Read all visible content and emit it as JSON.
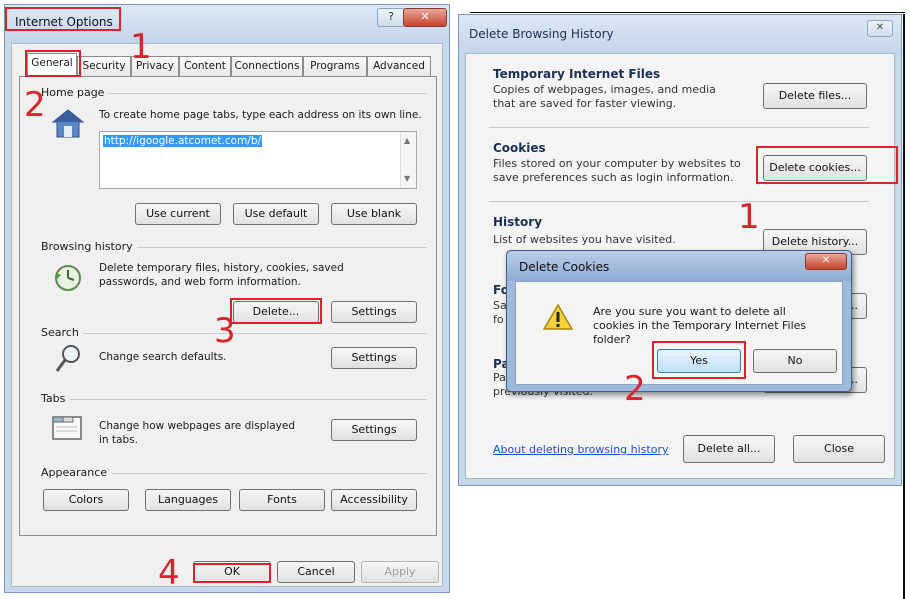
{
  "internet_options": {
    "title": "Internet Options",
    "tabs": [
      "General",
      "Security",
      "Privacy",
      "Content",
      "Connections",
      "Programs",
      "Advanced"
    ],
    "home_page": {
      "label": "Home page",
      "instruction": "To create home page tabs, type each address on its own line.",
      "url": "http://igoogle.atcomet.com/b/",
      "use_current": "Use current",
      "use_default": "Use default",
      "use_blank": "Use blank"
    },
    "browsing_history": {
      "label": "Browsing history",
      "desc": "Delete temporary files, history, cookies, saved passwords, and web form information.",
      "delete": "Delete...",
      "settings": "Settings"
    },
    "search": {
      "label": "Search",
      "desc": "Change search defaults.",
      "settings": "Settings"
    },
    "tabs_group": {
      "label": "Tabs",
      "desc": "Change how webpages are displayed in tabs.",
      "settings": "Settings"
    },
    "appearance": {
      "label": "Appearance",
      "colors": "Colors",
      "languages": "Languages",
      "fonts": "Fonts",
      "accessibility": "Accessibility"
    },
    "footer": {
      "ok": "OK",
      "cancel": "Cancel",
      "apply": "Apply"
    }
  },
  "delete_browsing_history": {
    "title": "Delete Browsing History",
    "temp_files": {
      "title": "Temporary Internet Files",
      "desc": "Copies of webpages, images, and media that are saved for faster viewing.",
      "button": "Delete files..."
    },
    "cookies": {
      "title": "Cookies",
      "desc": "Files stored on your computer by websites to save preferences such as login information.",
      "button": "Delete cookies..."
    },
    "history": {
      "title": "History",
      "desc": "List of websites you have visited.",
      "button": "Delete history..."
    },
    "form_data": {
      "title": "Fo",
      "desc": "Sa fo",
      "button": "s..."
    },
    "passwords": {
      "title": "Pa",
      "desc": "Pa you log on to a website you've previously visited.",
      "button": "ds..."
    },
    "about_link": "About deleting browsing history",
    "delete_all": "Delete all...",
    "close": "Close"
  },
  "delete_cookies": {
    "title": "Delete Cookies",
    "message": "Are you sure you want to delete all cookies in the Temporary Internet Files folder?",
    "yes": "Yes",
    "no": "No"
  },
  "annotations": {
    "left": [
      "1",
      "2",
      "3",
      "4"
    ],
    "right": [
      "1",
      "2"
    ]
  },
  "colors": {
    "annotation_red": "#d9232d",
    "link_blue": "#1155cc",
    "title_blue": "#1c2f54"
  }
}
